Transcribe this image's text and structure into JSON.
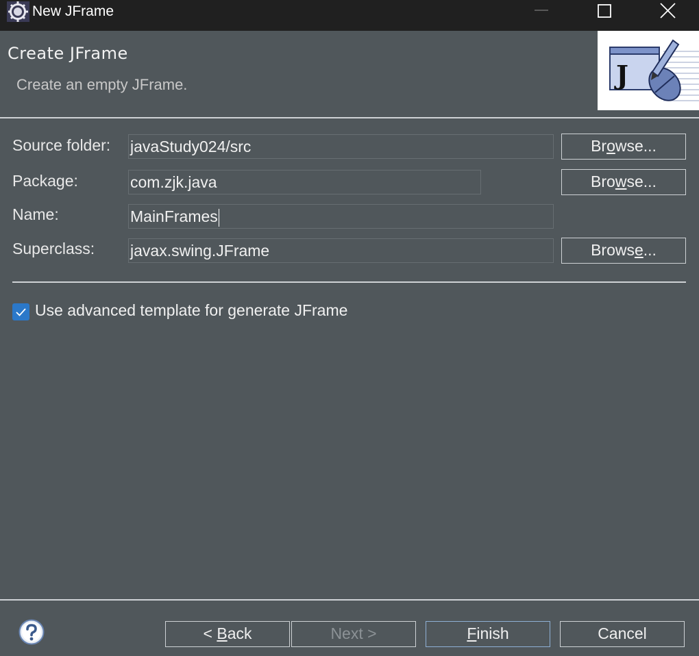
{
  "window": {
    "title": "New JFrame",
    "controls": [
      "minimize-icon",
      "maximize-icon",
      "close-icon"
    ]
  },
  "header": {
    "title": "Create JFrame",
    "description": "Create an empty JFrame.",
    "banner_icon": "jframe-wizard-icon",
    "banner_letter": "J"
  },
  "form": {
    "source_folder": {
      "label": "Source folder:",
      "value": "javaStudy024/src",
      "browse": {
        "before": "Br",
        "mnemonic": "o",
        "after": "wse..."
      }
    },
    "package": {
      "label": "Package:",
      "value": "com.zjk.java",
      "browse": {
        "before": "Bro",
        "mnemonic": "w",
        "after": "se..."
      }
    },
    "name": {
      "label": "Name:",
      "value": "MainFrames"
    },
    "superclass": {
      "label": "Superclass:",
      "value": "javax.swing.JFrame",
      "browse": {
        "before": "Brows",
        "mnemonic": "e",
        "after": "..."
      }
    }
  },
  "options": {
    "advanced_template": {
      "label": "Use advanced template for generate JFrame",
      "checked": true
    }
  },
  "footer": {
    "help_icon": "help-icon",
    "back": {
      "before": "< ",
      "mnemonic": "B",
      "after": "ack"
    },
    "next": "Next >",
    "finish": {
      "mnemonic": "F",
      "after": "inish"
    },
    "cancel": "Cancel"
  },
  "colors": {
    "background": "#50575b",
    "titlebar": "#202020",
    "checkbox_accent": "#2b78c9",
    "default_button_border": "#8fb1d6"
  }
}
